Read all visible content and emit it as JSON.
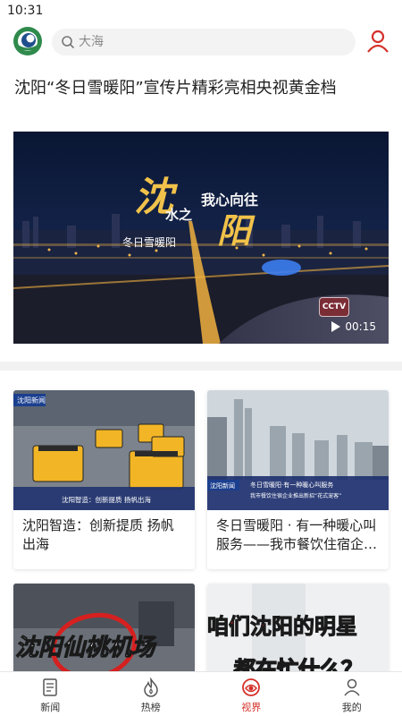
{
  "status_bar": {
    "time": "10:31"
  },
  "header": {
    "logo": "sunrise-logo-icon",
    "search": {
      "placeholder": "大海",
      "icon": "search-icon"
    },
    "profile_icon": "user-icon"
  },
  "headline": "沈阳“冬日雪暖阳”宣传片精彩亮相央视黄金档",
  "video": {
    "title_large": "沈",
    "title_small_a": "我心向往",
    "title_small_b": "水之",
    "title_small_c": "阳",
    "subtitle": "冬日雪暖阳",
    "cctv_badge": "CCTV",
    "duration": "00:15"
  },
  "cards": [
    {
      "caption": "沈阳智造：创新提质 扬帆出海",
      "overlay_text": "沈阳智造：创新提质 扬帆出海",
      "overlay_brand": "沈阳新闻"
    },
    {
      "caption": "冬日雪暖阳 · 有一种暖心叫服务——我市餐饮住宿企…",
      "overlay_text": "冬日雪暖阳·有一种暖心叫服务",
      "overlay_sub": "我市餐饮住宿企业推出新招“花式宠客”",
      "overlay_brand": "沈阳新闻"
    },
    {
      "caption": "",
      "overlay_text": "沈阳仙桃机场"
    },
    {
      "caption": "",
      "overlay_text": "咱们沈阳的明星",
      "overlay_sub": "都在忙什么？"
    }
  ],
  "tabs": [
    {
      "label": "新闻",
      "icon": "news-icon",
      "active": false
    },
    {
      "label": "热榜",
      "icon": "flame-icon",
      "active": false
    },
    {
      "label": "视界",
      "icon": "vision-icon",
      "active": true
    },
    {
      "label": "我的",
      "icon": "profile-icon",
      "active": false
    }
  ],
  "colors": {
    "accent": "#d4302a",
    "logo_green": "#2f8a4c",
    "logo_blue": "#1f4e8c"
  }
}
